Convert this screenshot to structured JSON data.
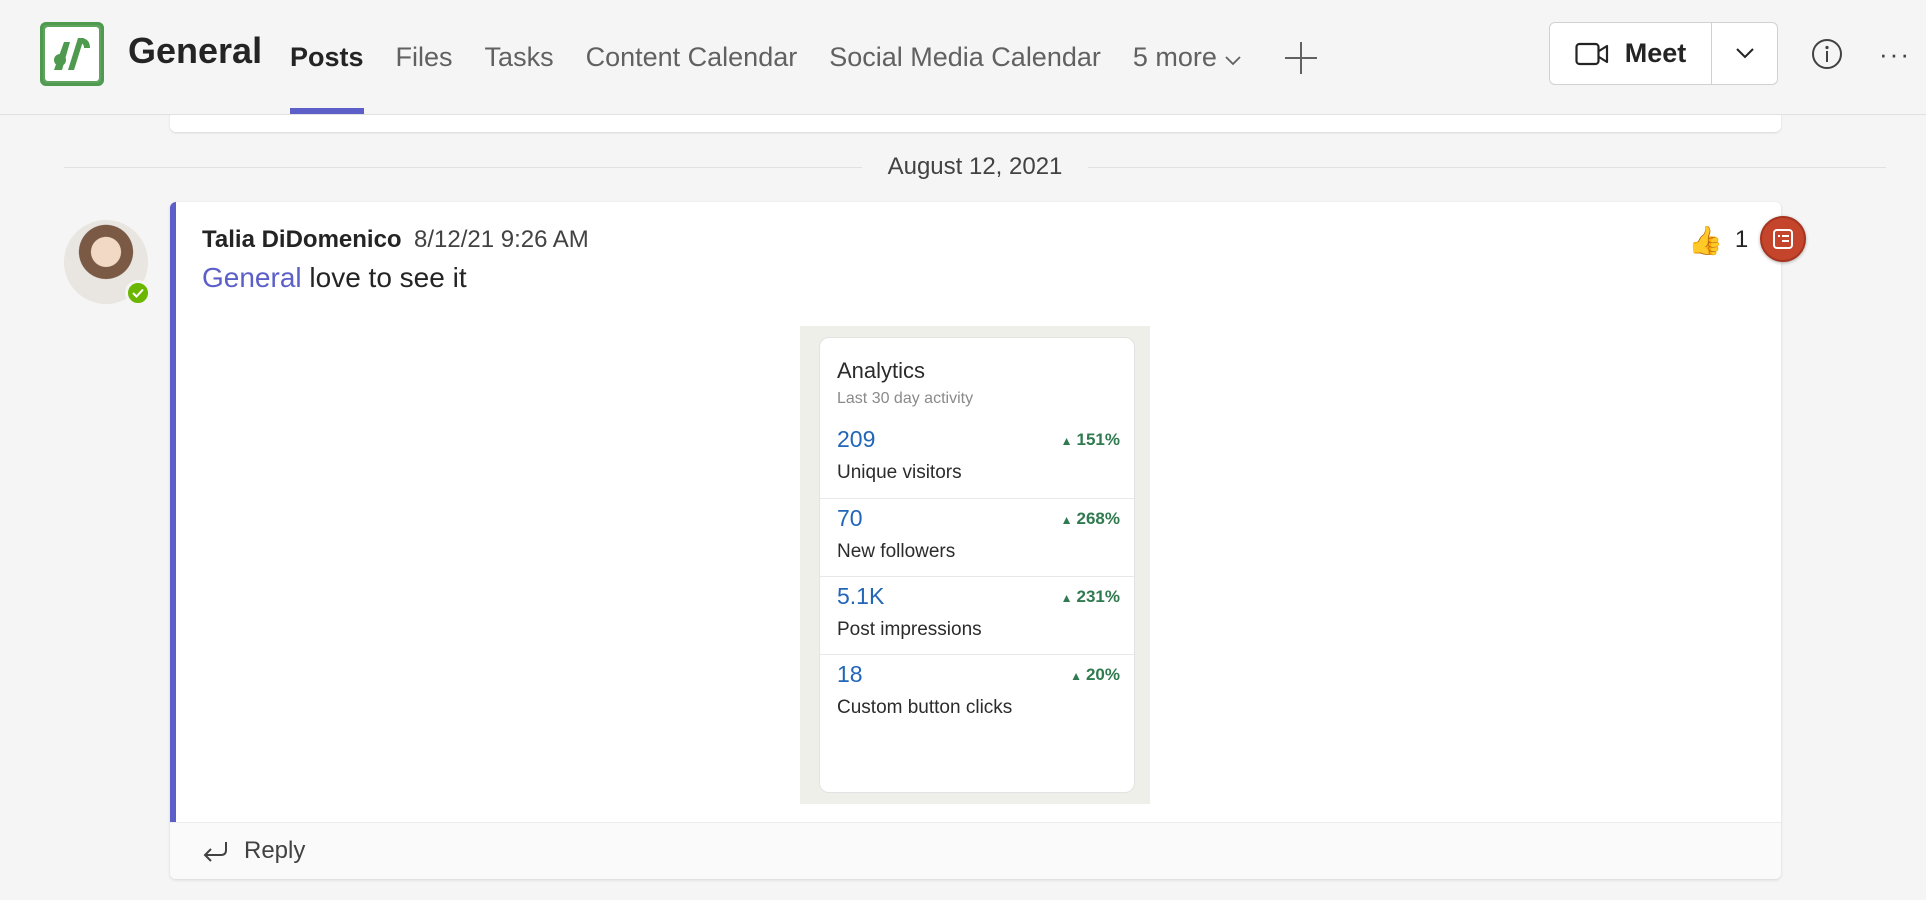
{
  "header": {
    "channel_title": "General",
    "tabs": [
      {
        "label": "Posts",
        "active": true
      },
      {
        "label": "Files",
        "active": false
      },
      {
        "label": "Tasks",
        "active": false
      },
      {
        "label": "Content Calendar",
        "active": false
      },
      {
        "label": "Social Media Calendar",
        "active": false
      }
    ],
    "more_tabs_label": "5 more",
    "meet_label": "Meet",
    "icons": {
      "team_logo": "team-logo-icon",
      "add_tab": "plus-icon",
      "meet": "video-camera-icon",
      "meet_dropdown": "chevron-down-icon",
      "info": "info-icon",
      "more": "more-options-icon"
    }
  },
  "feed": {
    "date_divider": "August 12, 2021",
    "post": {
      "author": "Talia DiDomenico",
      "timestamp": "8/12/21 9:26 AM",
      "mention": "General",
      "message_text": " love to see it",
      "presence": "available",
      "reaction": {
        "emoji": "👍",
        "count": "1"
      },
      "attachment": {
        "title": "Analytics",
        "subtitle": "Last 30 day activity",
        "metrics": [
          {
            "value": "209",
            "label": "Unique visitors",
            "change": "151%"
          },
          {
            "value": "70",
            "label": "New followers",
            "change": "268%"
          },
          {
            "value": "5.1K",
            "label": "Post impressions",
            "change": "231%"
          },
          {
            "value": "18",
            "label": "Custom button clicks",
            "change": "20%"
          }
        ]
      },
      "reply_label": "Reply"
    }
  },
  "colors": {
    "accent": "#5b5fc7",
    "presence_available": "#6bb700",
    "metric_value": "#2166b8",
    "metric_change": "#2f7a4f",
    "badge": "#c4452c"
  }
}
